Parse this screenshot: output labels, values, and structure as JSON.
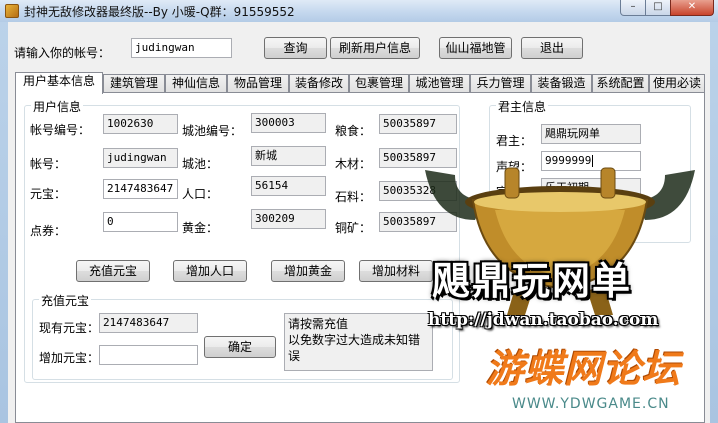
{
  "window": {
    "title": "封神无敌修改器最终版--By 小暖-Q群：91559552",
    "min_glyph": "–",
    "max_glyph": "□",
    "close_glyph": "✕"
  },
  "account": {
    "label": "请输入你的帐号：",
    "value": "judingwan",
    "query_button": "查询",
    "refresh_button": "刷新用户信息",
    "xianshan_button": "仙山福地管",
    "exit_button": "退出"
  },
  "tabs": [
    "用户基本信息",
    "建筑管理",
    "神仙信息",
    "物品管理",
    "装备修改",
    "包裹管理",
    "城池管理",
    "兵力管理",
    "装备锻造",
    "系统配置",
    "使用必读"
  ],
  "user_info": {
    "title": "用户信息",
    "account_id_label": "帐号编号：",
    "account_id": "1002630",
    "account_label": "帐号：",
    "account": "judingwan",
    "yuanbao_label": "元宝：",
    "yuanbao": "2147483647",
    "coupon_label": "点券：",
    "coupon": "0",
    "city_id_label": "城池编号：",
    "city_id": "300003",
    "city_label": "城池：",
    "city": "新城",
    "population_label": "人口：",
    "population": "56154",
    "gold_label": "黄金：",
    "gold": "300209",
    "grain_label": "粮食：",
    "grain": "50035897",
    "wood_label": "木材：",
    "wood": "50035897",
    "stone_label": "石料：",
    "stone": "50035328",
    "copper_label": "铜矿：",
    "copper": "50035897"
  },
  "actions": {
    "recharge_yuanbao": "充值元宝",
    "add_population": "增加人口",
    "add_gold": "增加黄金",
    "add_material": "增加材料"
  },
  "recharge": {
    "title": "充值元宝",
    "current_label": "现有元宝：",
    "current": "2147483647",
    "add_label": "增加元宝：",
    "add_value": "",
    "confirm_button": "确定",
    "note_line1": "请按需充值",
    "note_line2": "以免数字过大造成未知错误"
  },
  "lord_info": {
    "title": "君主信息",
    "lord_label": "君主：",
    "lord": "飓鼎玩网单",
    "prestige_label": "声望：",
    "prestige": "9999999",
    "rank_label": "官职：",
    "rank": "乐天初期"
  },
  "watermark": {
    "brand": "飓鼎玩网单",
    "url": "http://jdwan.taobao.com",
    "forum": "游蝶网论坛",
    "site": "WWW.YDWGAME.CN",
    "gold_color": "#d4a431",
    "forum_color": "#f07a1a"
  }
}
